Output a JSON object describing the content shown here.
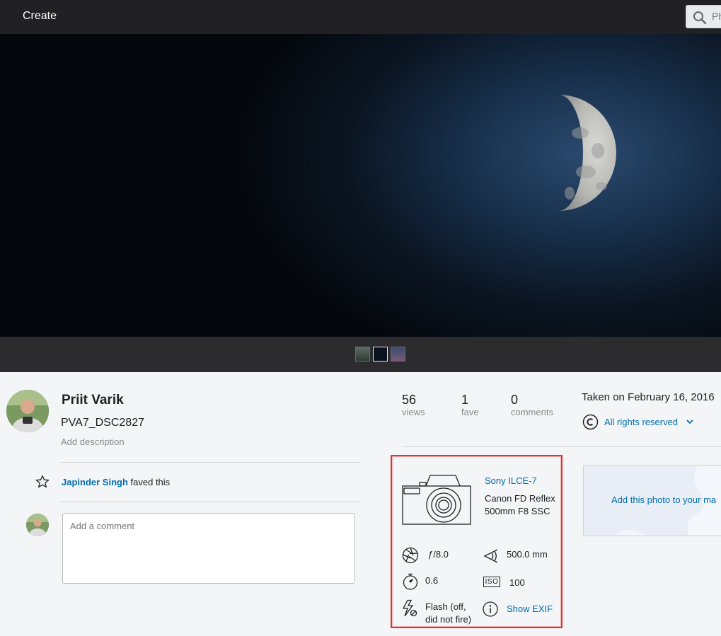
{
  "topbar": {
    "create_label": "Create",
    "search_placeholder": "Ph"
  },
  "filmstrip": {
    "thumb_count": 3,
    "active_index": 1
  },
  "owner": {
    "name": "Priit Varik",
    "photo_title": "PVA7_DSC2827",
    "add_description": "Add description"
  },
  "activity": {
    "faver_name": "Japinder Singh",
    "faved_text": "faved this",
    "comment_placeholder": "Add a comment"
  },
  "stats": {
    "views_count": "56",
    "views_label": "views",
    "faves_count": "1",
    "faves_label": "fave",
    "comments_count": "0",
    "comments_label": "comments"
  },
  "taken": "Taken on February 16, 2016",
  "license": {
    "label": "All rights reserved"
  },
  "exif": {
    "camera_model": "Sony ILCE-7",
    "lens": "Canon FD Reflex 500mm F8 SSC",
    "aperture": "ƒ/8.0",
    "focal_length": "500.0 mm",
    "exposure": "0.6",
    "iso_badge": "ISO",
    "iso": "100",
    "flash": "Flash (off, did not fire)",
    "show_exif": "Show EXIF"
  },
  "gallery": {
    "add_label": "Add this photo to your ma"
  },
  "colors": {
    "topbar_bg": "#212124",
    "link_blue": "#006dac",
    "highlight_red": "#d9393b",
    "page_bg": "#f3f5f6"
  }
}
